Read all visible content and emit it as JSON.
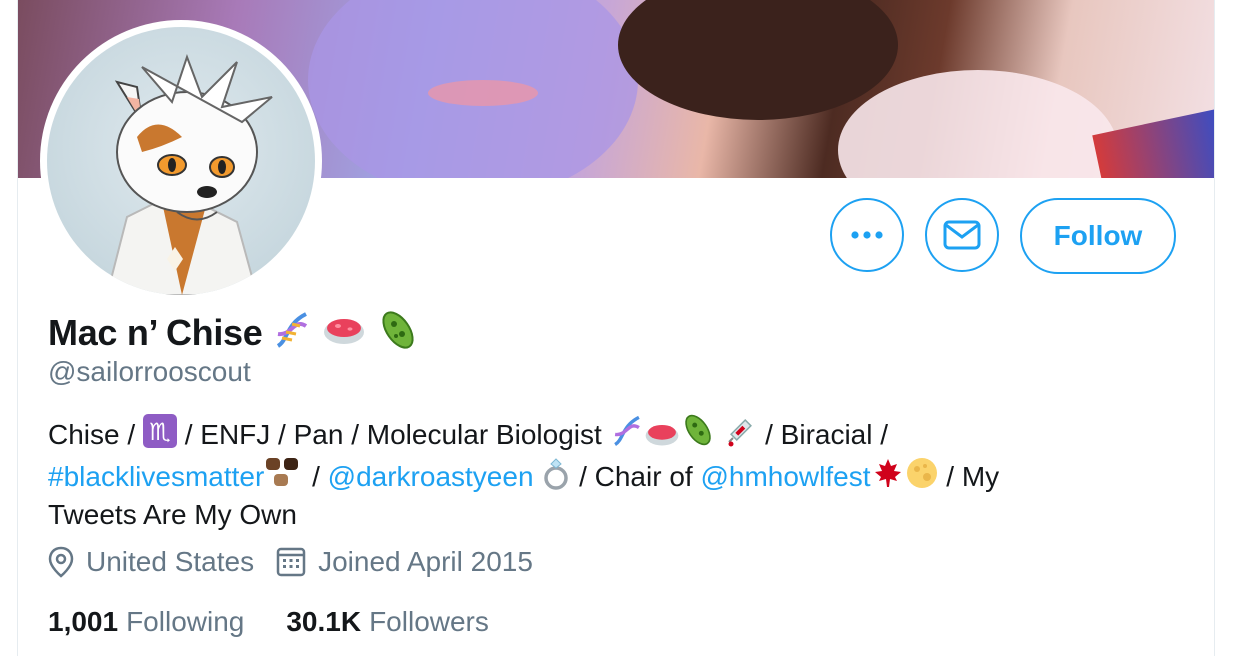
{
  "profile": {
    "display_name": "Mac n’ Chise",
    "handle": "@sailorrooscout",
    "bio": {
      "p1": "Chise / ",
      "p2": " / ENFJ / Pan / Molecular Biologist ",
      "p3": " / Biracial /",
      "hashtag": "#blacklivesmatter",
      "p4": " / ",
      "mention1": "@darkroastyeen",
      "p5": " / Chair of ",
      "mention2": "@hmhowlfest",
      "p6": " / My",
      "p7": "Tweets Are My Own"
    },
    "location": "United States",
    "joined": "Joined April 2015",
    "following_count": "1,001",
    "following_label": "Following",
    "followers_count": "30.1K",
    "followers_label": "Followers"
  },
  "actions": {
    "follow_label": "Follow",
    "more_icon": "more-icon",
    "message_icon": "envelope-icon"
  },
  "colors": {
    "accent": "#1da1f2",
    "secondary_text": "#657786",
    "primary_text": "#14171a"
  }
}
